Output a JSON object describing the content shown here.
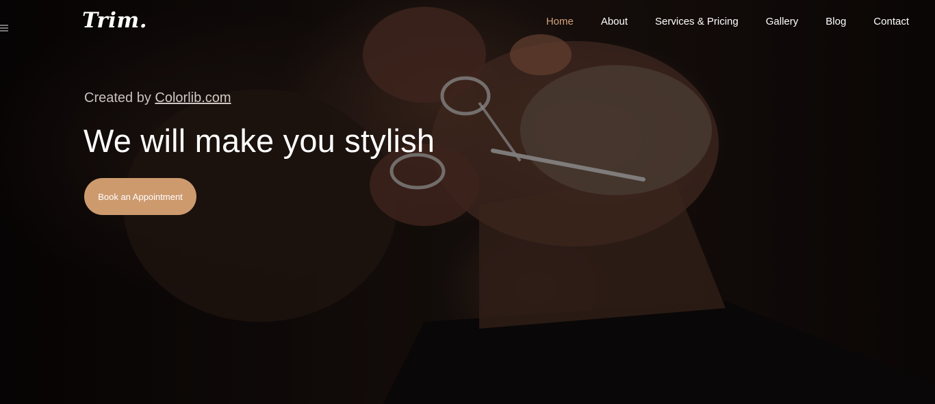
{
  "brand": {
    "logo": "Trim."
  },
  "nav": {
    "items": [
      {
        "label": "Home",
        "active": true
      },
      {
        "label": "About",
        "active": false
      },
      {
        "label": "Services & Pricing",
        "active": false
      },
      {
        "label": "Gallery",
        "active": false
      },
      {
        "label": "Blog",
        "active": false
      },
      {
        "label": "Contact",
        "active": false
      }
    ]
  },
  "hero": {
    "created_prefix": "Created by",
    "created_link": "Colorlib.com",
    "headline": "We will make you stylish",
    "cta_label": "Book an Appointment"
  },
  "colors": {
    "accent": "#cd9a6e",
    "nav_active": "#d3a37a",
    "text": "#ffffff"
  },
  "icons": {
    "menu": "hamburger-icon"
  }
}
